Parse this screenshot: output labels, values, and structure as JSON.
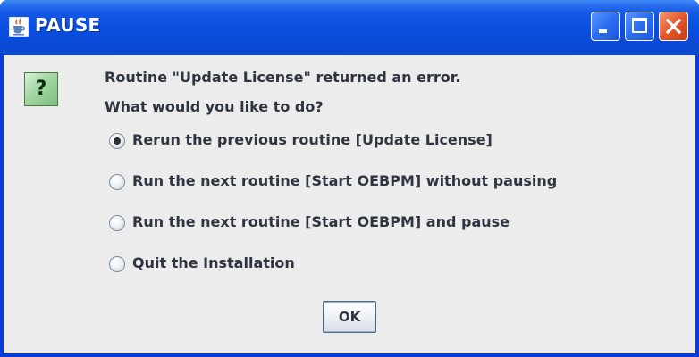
{
  "window": {
    "title": "PAUSE",
    "title_icon": "java-cup-icon",
    "controls": [
      "minimize-icon",
      "maximize-icon",
      "close-icon"
    ]
  },
  "dialog": {
    "icon": "question-icon",
    "icon_glyph": "?",
    "message_line1": "Routine \"Update License\" returned an error.",
    "message_line2": "What would you like to do?",
    "options": [
      {
        "label": "Rerun the previous routine [Update License]",
        "selected": true
      },
      {
        "label": "Run the next routine [Start OEBPM] without pausing",
        "selected": false
      },
      {
        "label": "Run the next routine [Start OEBPM] and pause",
        "selected": false
      },
      {
        "label": "Quit the Installation",
        "selected": false
      }
    ],
    "ok_label": "OK"
  },
  "colors": {
    "titlebar": "#0a4fe0",
    "client_background": "#ececec",
    "text": "#2e3440",
    "close_button": "#e2582c",
    "question_icon_fill": "#a3d6a3"
  }
}
